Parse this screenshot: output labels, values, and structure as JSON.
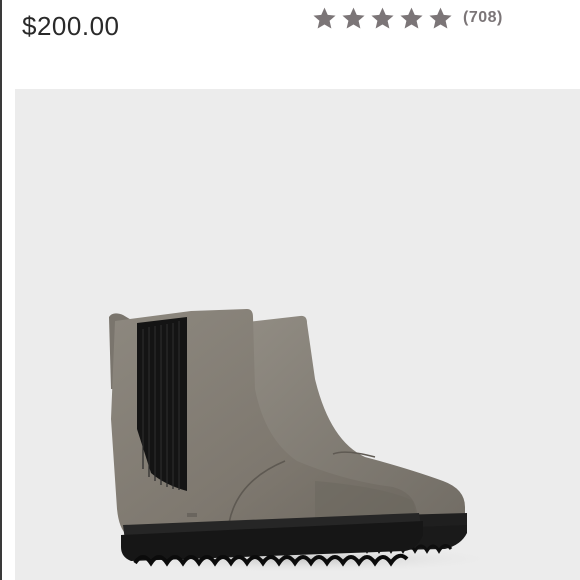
{
  "product": {
    "price": "$200.00",
    "rating": {
      "stars_filled": 5,
      "stars_total": 5,
      "count_text": "(708)",
      "star_color": "#7b7577"
    },
    "image": {
      "subject": "boot",
      "color": "#847f76"
    }
  }
}
